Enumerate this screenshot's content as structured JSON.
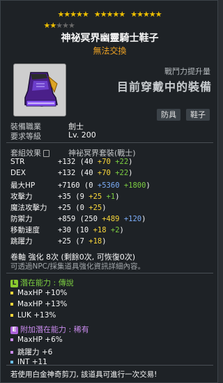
{
  "stars": {
    "row1_groups": [
      5,
      5,
      5
    ],
    "row2_filled": 2,
    "row2_empty": 3,
    "filled_color": "#f6c500",
    "empty_color": "#6a6a6a"
  },
  "item": {
    "name": "神祕冥界幽靈騎士鞋子",
    "trade_note": "無法交換",
    "icon": "purple-shoe-icon"
  },
  "combat": {
    "label": "戰鬥力提升量",
    "value": "目前穿戴中的裝備"
  },
  "tags": [
    "防具",
    "鞋子"
  ],
  "requirements": [
    {
      "label": "裝備職業",
      "value": "劍士"
    },
    {
      "label": "要求等級",
      "value": "Lv. 200"
    }
  ],
  "set": {
    "label": "套組效果",
    "name": "神祕冥界套裝(戰士)"
  },
  "stats": [
    {
      "label": "STR",
      "total": "+132",
      "base": "40",
      "extra": [
        {
          "text": "+70",
          "color": "yellow"
        },
        {
          "text": "+22",
          "color": "green"
        }
      ]
    },
    {
      "label": "DEX",
      "total": "+132",
      "base": "40",
      "extra": [
        {
          "text": "+70",
          "color": "yellow"
        },
        {
          "text": "+22",
          "color": "green"
        }
      ]
    },
    {
      "label": "最大HP",
      "total": "+7160",
      "base": "0",
      "extra": [
        {
          "text": "+5360",
          "color": "blue"
        },
        {
          "text": "+1800",
          "color": "green"
        }
      ]
    },
    {
      "label": "攻擊力",
      "total": "+35",
      "base": "9",
      "extra": [
        {
          "text": "+25",
          "color": "yellow"
        },
        {
          "text": "+1",
          "color": "green"
        }
      ]
    },
    {
      "label": "魔法攻擊力",
      "total": "+25",
      "base": "0",
      "extra": [
        {
          "text": "+25",
          "color": "yellow"
        }
      ]
    },
    {
      "label": "防禦力",
      "total": "+859",
      "base": "250",
      "extra": [
        {
          "text": "+489",
          "color": "yellow"
        },
        {
          "text": "+120",
          "color": "blue"
        }
      ]
    },
    {
      "label": "移動速度",
      "total": "+30",
      "base": "10",
      "extra": [
        {
          "text": "+18",
          "color": "yellow"
        },
        {
          "text": "+2",
          "color": "green"
        }
      ]
    },
    {
      "label": "跳躍力",
      "total": "+25",
      "base": "7",
      "extra": [
        {
          "text": "+18",
          "color": "yellow"
        }
      ]
    }
  ],
  "enhance": {
    "line1": "卷軸 強化 8次 (剩餘0次, 可恢復0次)",
    "line2": "可透過NPC/採集道具強化資訊詳細內容。"
  },
  "potential": {
    "badge": "L",
    "title": "潛在能力 : 傳說",
    "lines": [
      "MaxHP +10%",
      "MaxHP +13%",
      "LUK +13%"
    ]
  },
  "additional": {
    "badge": "E",
    "title": "附加潛在能力 : 稀有",
    "lines": [
      "MaxHP +6%",
      "跳躍力 +6",
      "INT +11"
    ]
  },
  "footer": "若使用白金神奇剪刀, 該道具可進行一次交易!"
}
